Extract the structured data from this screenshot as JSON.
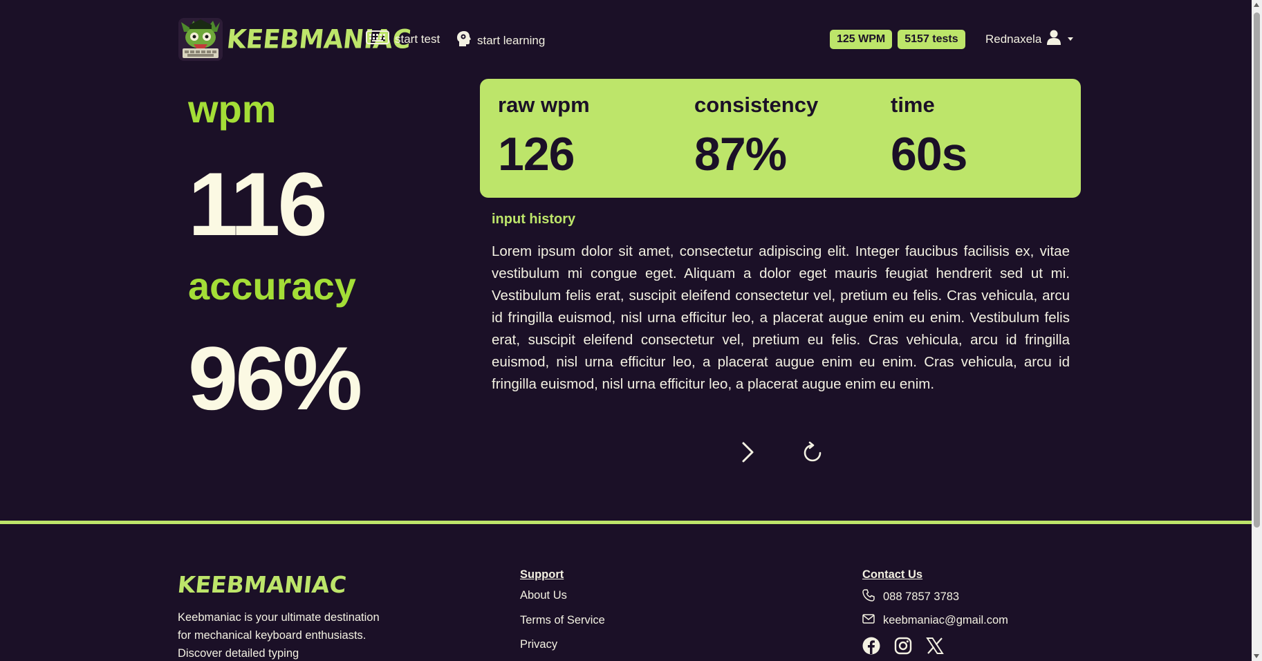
{
  "nav": {
    "brand": "KEEBMANIAC",
    "start_test": "start test",
    "start_learning": "start learning",
    "badge_wpm": "125 WPM",
    "badge_tests": "5157 tests",
    "username": "Rednaxela"
  },
  "results": {
    "wpm_label": "wpm",
    "wpm_value": "116",
    "accuracy_label": "accuracy",
    "accuracy_value": "96%"
  },
  "card": {
    "raw_label": "raw wpm",
    "raw_value": "126",
    "consistency_label": "consistency",
    "consistency_value": "87%",
    "time_label": "time",
    "time_value": "60s"
  },
  "history": {
    "title": "input history",
    "text": "Lorem ipsum dolor sit amet, consectetur adipiscing elit. Integer faucibus facilisis ex, vitae vestibulum mi congue eget. Aliquam a dolor eget mauris feugiat hendrerit sed ut mi. Vestibulum felis erat, suscipit eleifend consectetur vel, pretium eu felis. Cras vehicula, arcu id fringilla euismod, nisl urna efficitur leo, a placerat augue enim eu enim. Vestibulum felis erat, suscipit eleifend consectetur vel, pretium eu felis. Cras vehicula, arcu id fringilla euismod, nisl urna efficitur leo, a placerat augue enim eu enim. Cras vehicula, arcu id fringilla euismod, nisl urna efficitur leo, a placerat augue enim eu enim."
  },
  "footer": {
    "brand": "KEEBMANIAC",
    "description": "Keebmaniac is your ultimate destination for mechanical keyboard enthusiasts. Discover detailed typing",
    "support_title": "Support",
    "support_links": [
      "About Us",
      "Terms of Service",
      "Privacy"
    ],
    "contact_title": "Contact Us",
    "phone": "088 7857 3783",
    "email": "keebmaniac@gmail.com",
    "socials": [
      "facebook-icon",
      "instagram-icon",
      "x-icon"
    ]
  },
  "colors": {
    "background": "#1b1027",
    "accent": "#bde56a",
    "accent_dark": "#a4de37",
    "text": "#fbf9e3"
  }
}
